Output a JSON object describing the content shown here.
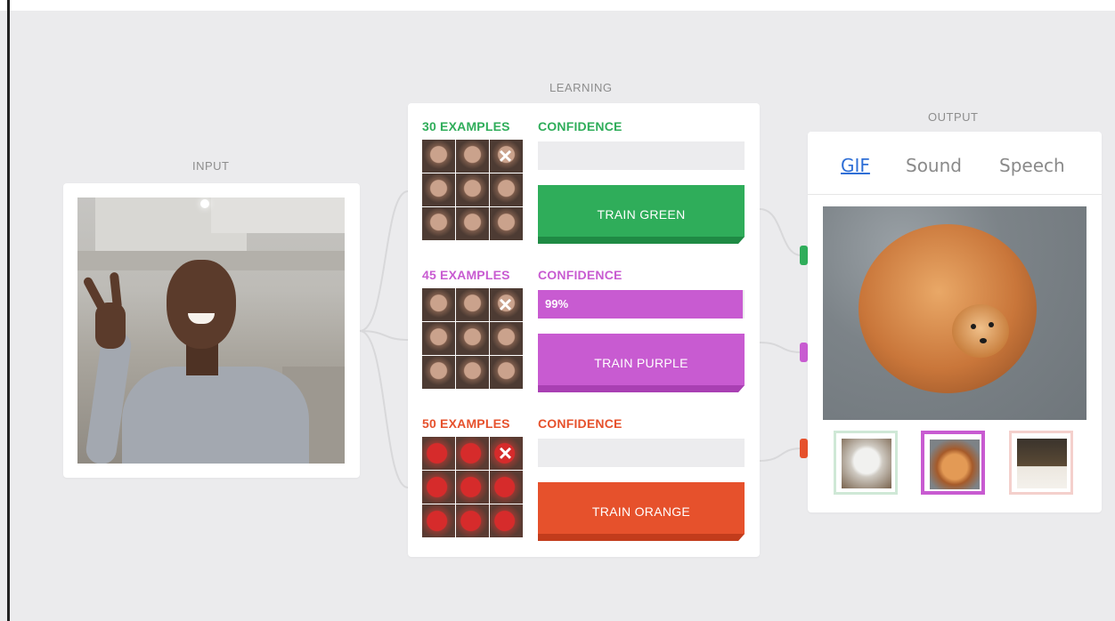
{
  "sections": {
    "input_label": "INPUT",
    "learning_label": "LEARNING",
    "output_label": "OUTPUT"
  },
  "classes": [
    {
      "id": "green",
      "examples_label": "30 EXAMPLES",
      "confidence_label": "CONFIDENCE",
      "confidence_value": "",
      "confidence_percent": 0,
      "train_label": "TRAIN GREEN",
      "color": "#2fad5a",
      "color_dark": "#1f8a44",
      "thumb_style": "face"
    },
    {
      "id": "purple",
      "examples_label": "45 EXAMPLES",
      "confidence_label": "CONFIDENCE",
      "confidence_value": "99%",
      "confidence_percent": 99,
      "train_label": "TRAIN PURPLE",
      "color": "#c85bd1",
      "color_dark": "#a940b3",
      "thumb_style": "face"
    },
    {
      "id": "orange",
      "examples_label": "50 EXAMPLES",
      "confidence_label": "CONFIDENCE",
      "confidence_value": "",
      "confidence_percent": 0,
      "train_label": "TRAIN ORANGE",
      "color": "#e6512c",
      "color_dark": "#c23c1c",
      "thumb_style": "red"
    }
  ],
  "output": {
    "tabs": [
      {
        "label": "GIF",
        "active": true
      },
      {
        "label": "Sound",
        "active": false
      },
      {
        "label": "Speech",
        "active": false
      }
    ],
    "gif_options": [
      {
        "icon": "white-dog-gif",
        "border_color": "#cfe8d6"
      },
      {
        "icon": "pomeranian-gif",
        "border_color": "#c85bd1"
      },
      {
        "icon": "black-dog-gif",
        "border_color": "#f4d0cc"
      }
    ]
  },
  "icons": {
    "delete": "×"
  }
}
